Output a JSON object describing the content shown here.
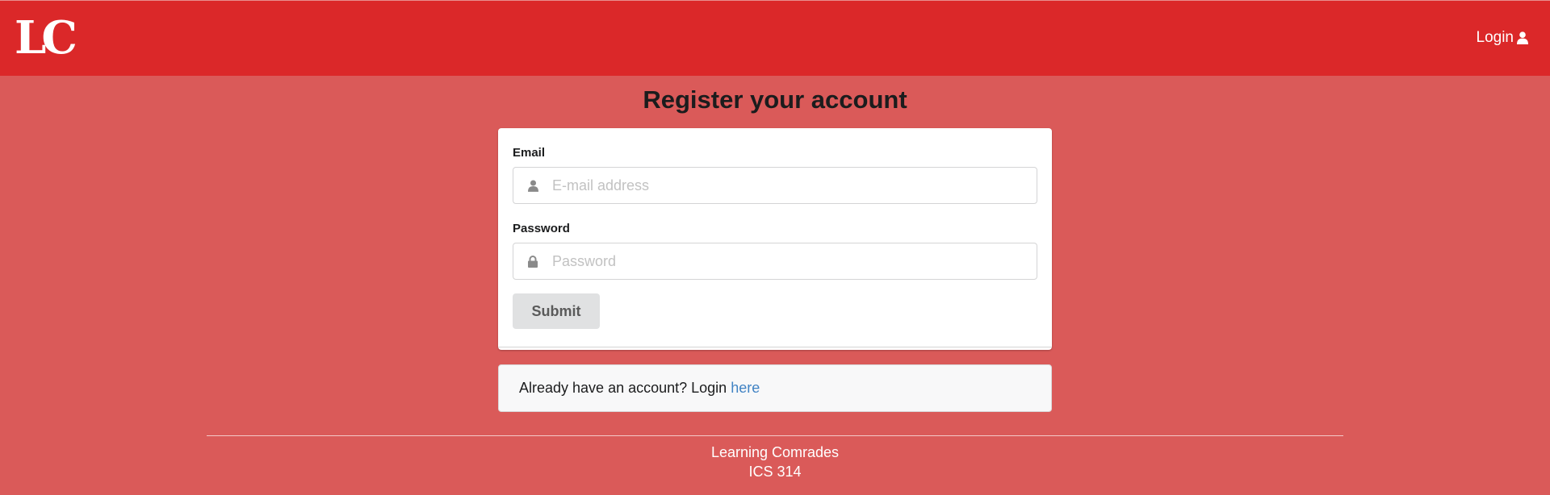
{
  "header": {
    "logo_text": "LC",
    "login_label": "Login",
    "login_icon": "user-icon"
  },
  "page": {
    "title": "Register your account"
  },
  "form": {
    "email_label": "Email",
    "email_placeholder": "E-mail address",
    "email_value": "",
    "email_icon": "user-icon",
    "password_label": "Password",
    "password_placeholder": "Password",
    "password_value": "",
    "password_icon": "lock-icon",
    "submit_label": "Submit"
  },
  "message": {
    "text": "Already have an account? Login ",
    "link_label": "here"
  },
  "footer": {
    "line1": "Learning Comrades",
    "line2": "ICS 314"
  },
  "colors": {
    "page_background": "#da5a59",
    "navbar_background": "#db2829",
    "link": "#4183c4"
  }
}
